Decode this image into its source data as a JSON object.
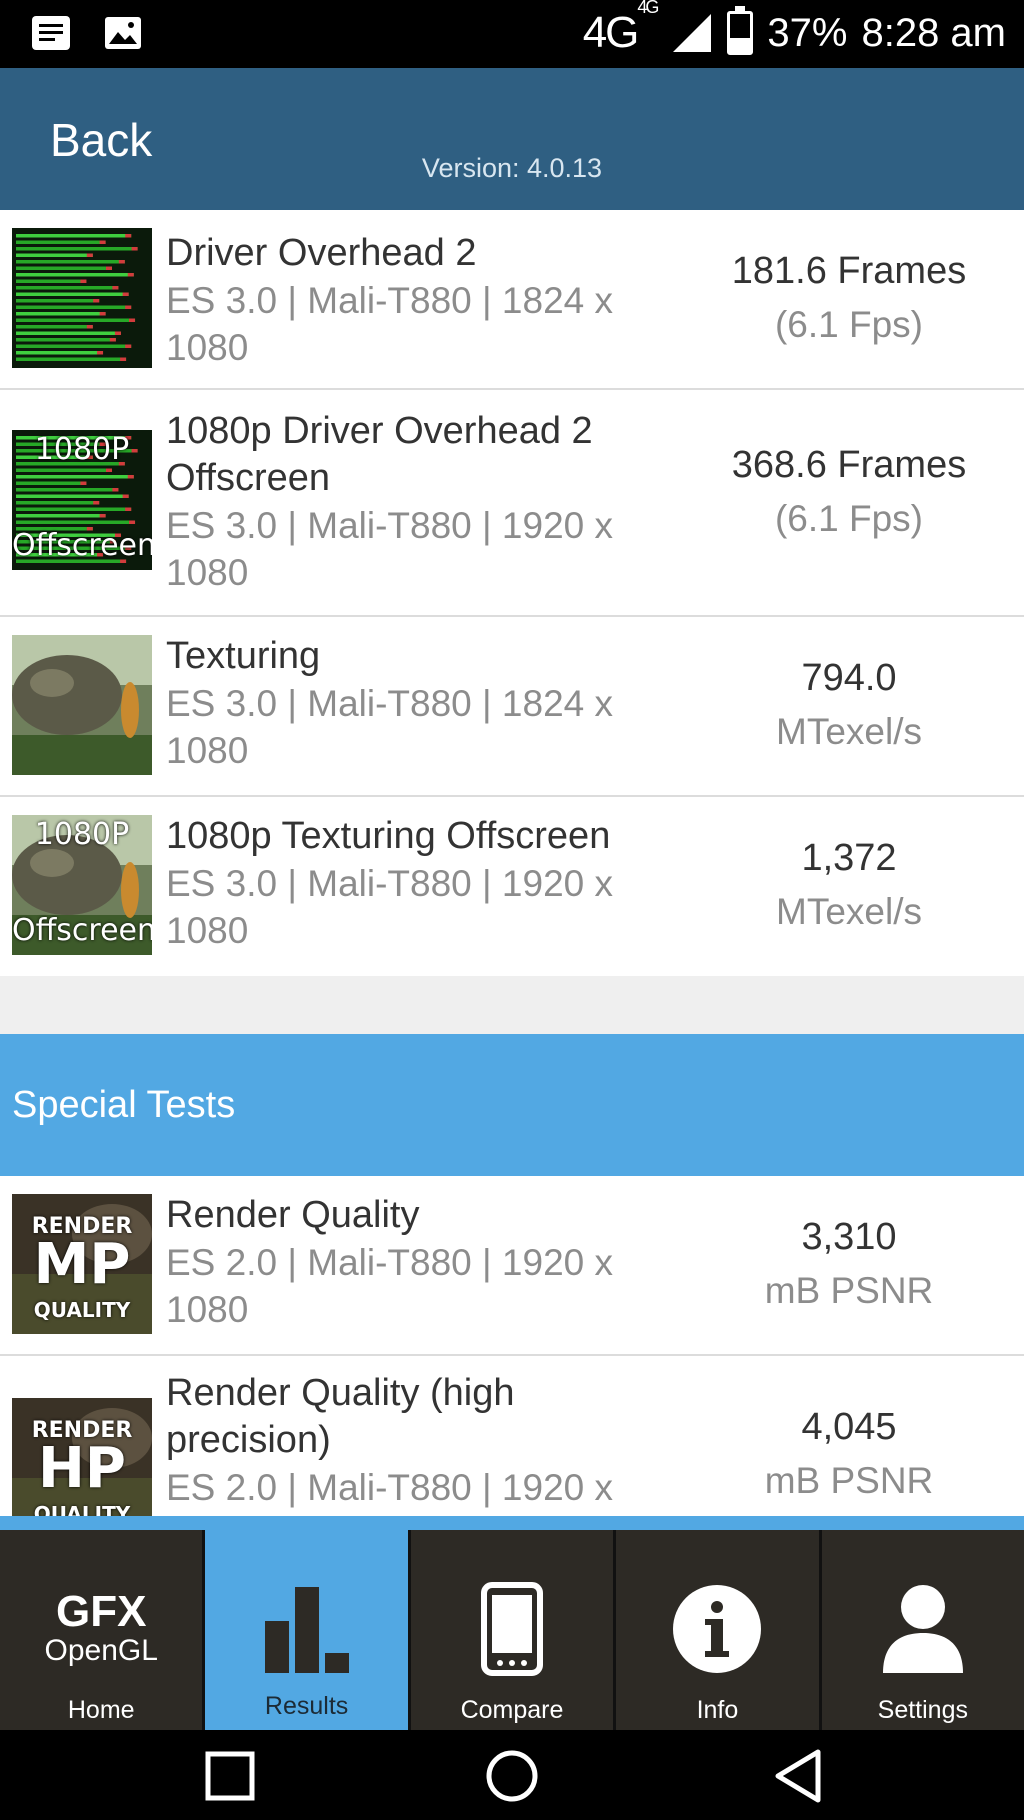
{
  "status_bar": {
    "network": "4G",
    "network_sup": "4G",
    "battery_percent": "37%",
    "battery_level": 0.37,
    "time": "8:28 am"
  },
  "header": {
    "back_label": "Back",
    "version": "Version: 4.0.13"
  },
  "results": [
    {
      "name": "Driver Overhead 2",
      "spec": "ES 3.0 | Mali-T880 | 1824 x 1080",
      "score": "181.6 Frames",
      "sub": "(6.1 Fps)",
      "thumb": "driver-overhead",
      "thumb_top": "",
      "thumb_bottom": ""
    },
    {
      "name": "1080p Driver Overhead 2 Offscreen",
      "spec": "ES 3.0 | Mali-T880 | 1920 x 1080",
      "score": "368.6 Frames",
      "sub": "(6.1 Fps)",
      "thumb": "driver-overhead",
      "thumb_top": "1080P",
      "thumb_bottom": "Offscreen"
    },
    {
      "name": "Texturing",
      "spec": "ES 3.0 | Mali-T880 | 1824 x 1080",
      "score": "794.0",
      "sub": "MTexel/s",
      "thumb": "texturing",
      "thumb_top": "",
      "thumb_bottom": ""
    },
    {
      "name": "1080p Texturing Offscreen",
      "spec": "ES 3.0 | Mali-T880 | 1920 x 1080",
      "score": "1,372",
      "sub": "MTexel/s",
      "thumb": "texturing",
      "thumb_top": "1080P",
      "thumb_bottom": "Offscreen"
    }
  ],
  "special_section": {
    "title": "Special Tests"
  },
  "special_results": [
    {
      "name": "Render Quality",
      "spec": "ES 2.0 | Mali-T880 | 1920 x 1080",
      "score": "3,310",
      "sub": "mB PSNR",
      "badge_top": "RENDER",
      "badge_main": "MP",
      "badge_bottom": "QUALITY"
    },
    {
      "name": "Render Quality (high precision)",
      "spec": "ES 2.0 | Mali-T880 | 1920 x",
      "score": "4,045",
      "sub": "mB PSNR",
      "badge_top": "RENDER",
      "badge_main": "HP",
      "badge_bottom": "QUALITY"
    }
  ],
  "tabs": [
    {
      "label": "Home",
      "icon": "gfx-opengl-logo",
      "logo_line1": "GFX",
      "logo_line2": "OpenGL",
      "active": false
    },
    {
      "label": "Results",
      "icon": "bar-chart-icon",
      "active": true
    },
    {
      "label": "Compare",
      "icon": "phone-icon",
      "active": false
    },
    {
      "label": "Info",
      "icon": "info-icon",
      "active": false
    },
    {
      "label": "Settings",
      "icon": "user-icon",
      "active": false
    }
  ],
  "colors": {
    "header": "#2f5f82",
    "accent": "#52a8e3",
    "tabbar": "#2d2a25"
  }
}
